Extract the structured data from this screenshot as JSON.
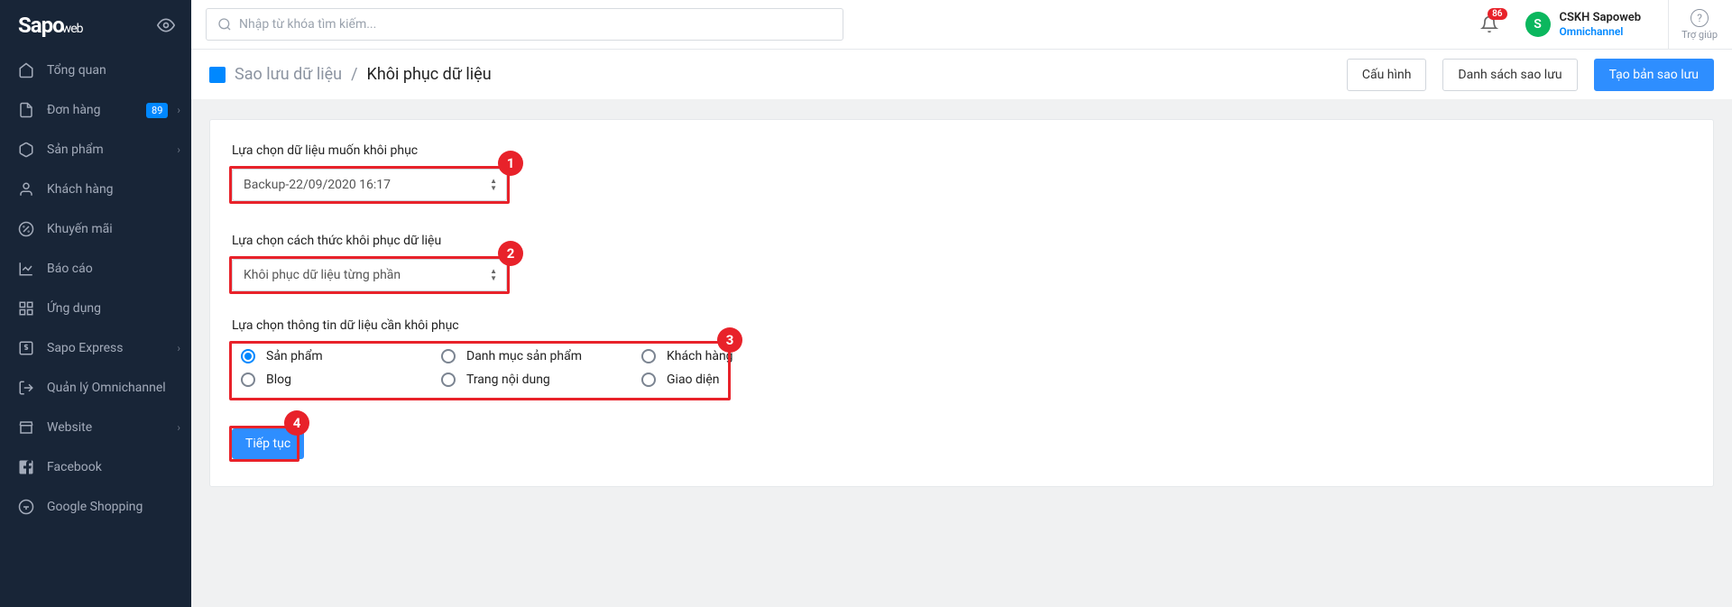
{
  "logo": {
    "main": "Sapo",
    "sub": "web"
  },
  "search": {
    "placeholder": "Nhập từ khóa tìm kiếm..."
  },
  "notifications": {
    "count": "86"
  },
  "account": {
    "initial": "S",
    "name": "CSKH Sapoweb",
    "sub": "Omnichannel"
  },
  "help": {
    "label": "Trợ giúp"
  },
  "sidebar": {
    "items": [
      {
        "label": "Tổng quan"
      },
      {
        "label": "Đơn hàng",
        "badge": "89",
        "expandable": true
      },
      {
        "label": "Sản phẩm",
        "expandable": true
      },
      {
        "label": "Khách hàng"
      },
      {
        "label": "Khuyến mãi"
      },
      {
        "label": "Báo cáo"
      },
      {
        "label": "Ứng dụng"
      },
      {
        "label": "Sapo Express",
        "expandable": true
      },
      {
        "label": "Quản lý Omnichannel"
      },
      {
        "label": "Website",
        "expandable": true
      },
      {
        "label": "Facebook"
      },
      {
        "label": "Google Shopping"
      }
    ]
  },
  "breadcrumb": {
    "link": "Sao lưu dữ liệu",
    "sep": "/",
    "current": "Khôi phục dữ liệu"
  },
  "actions": {
    "config": "Cấu hình",
    "list": "Danh sách sao lưu",
    "create": "Tạo bản sao lưu"
  },
  "form": {
    "select1_label": "Lựa chọn dữ liệu muốn khôi phục",
    "select1_value": "Backup-22/09/2020 16:17",
    "select2_label": "Lựa chọn cách thức khôi phục dữ liệu",
    "select2_value": "Khôi phục dữ liệu từng phần",
    "radios_label": "Lựa chọn thông tin dữ liệu cần khôi phục",
    "radio_options": [
      {
        "label": "Sản phẩm",
        "checked": true
      },
      {
        "label": "Danh mục sản phẩm"
      },
      {
        "label": "Khách hàng"
      },
      {
        "label": "Blog"
      },
      {
        "label": "Trang nội dung"
      },
      {
        "label": "Giao diện"
      }
    ],
    "continue": "Tiếp tục"
  },
  "annotations": {
    "a1": "1",
    "a2": "2",
    "a3": "3",
    "a4": "4"
  }
}
